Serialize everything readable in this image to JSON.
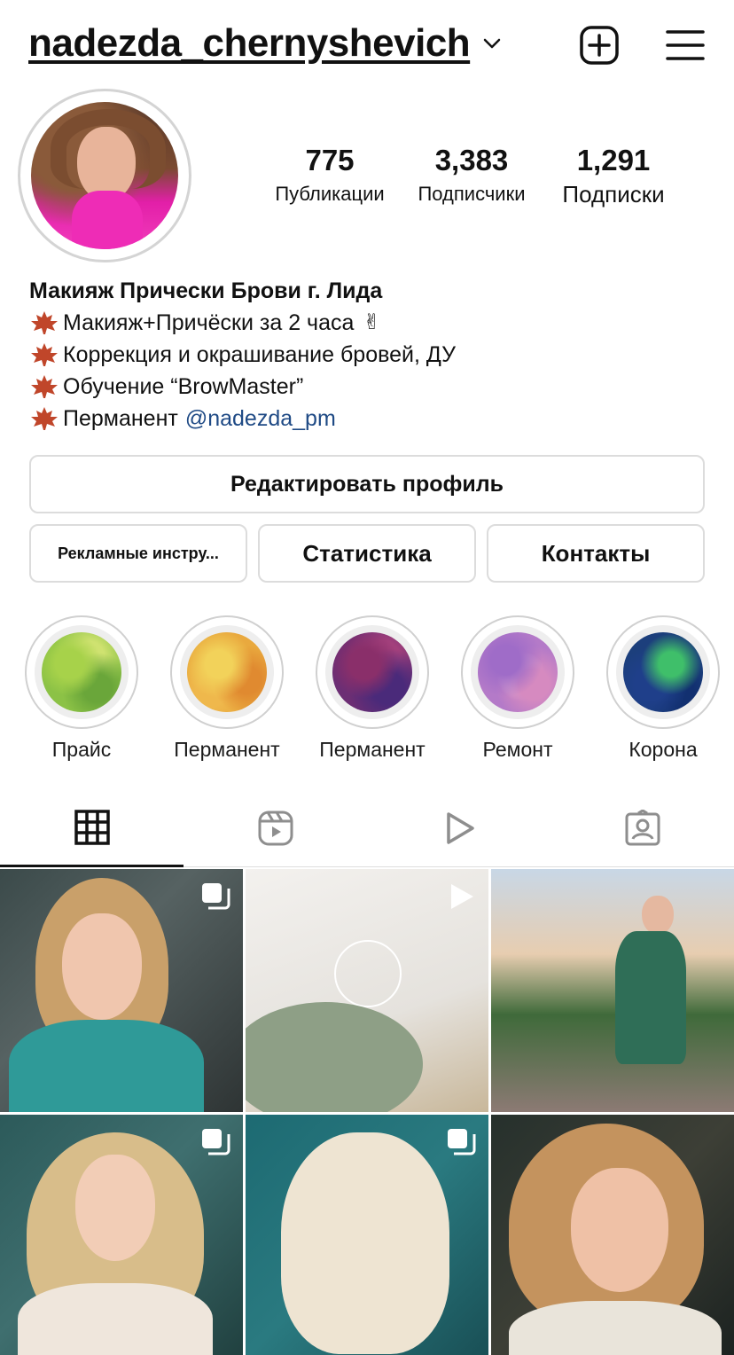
{
  "header": {
    "username": "nadezda_chernyshevich",
    "icons": [
      "chevron-down-icon",
      "new-post-icon",
      "menu-icon"
    ]
  },
  "stats": {
    "posts": {
      "count": "775",
      "label": "Публикации"
    },
    "followers": {
      "count": "3,383",
      "label": "Подписчики"
    },
    "following": {
      "count": "1,291",
      "label": "Подписки"
    }
  },
  "bio": {
    "name": "Макияж Прически Брови г. Лида",
    "lines": [
      "Макияж+Причёски за 2 часа",
      "Коррекция и окрашивание бровей, ДУ",
      "Обучение “BrowMaster”",
      "Перманент"
    ],
    "victory_emoji": "✌",
    "mention": "@nadezda_pm",
    "colors": {
      "mention": "#1f4a85",
      "leaf": "#c0462a"
    }
  },
  "buttons": {
    "edit_profile": "Редактировать профиль",
    "ad_tools": "Рекламные инстру...",
    "statistics": "Статистика",
    "contacts": "Контакты"
  },
  "highlights": [
    {
      "label": "Прайс"
    },
    {
      "label": "Перманент"
    },
    {
      "label": "Перманент"
    },
    {
      "label": "Ремонт"
    },
    {
      "label": "Корона"
    }
  ],
  "tabs": {
    "items": [
      "grid-icon",
      "reels-icon",
      "video-icon",
      "tagged-icon"
    ],
    "active": "grid-icon"
  },
  "posts": [
    {
      "type": "carousel"
    },
    {
      "type": "video"
    },
    {
      "type": "photo"
    },
    {
      "type": "carousel"
    },
    {
      "type": "carousel"
    },
    {
      "type": "photo"
    }
  ]
}
